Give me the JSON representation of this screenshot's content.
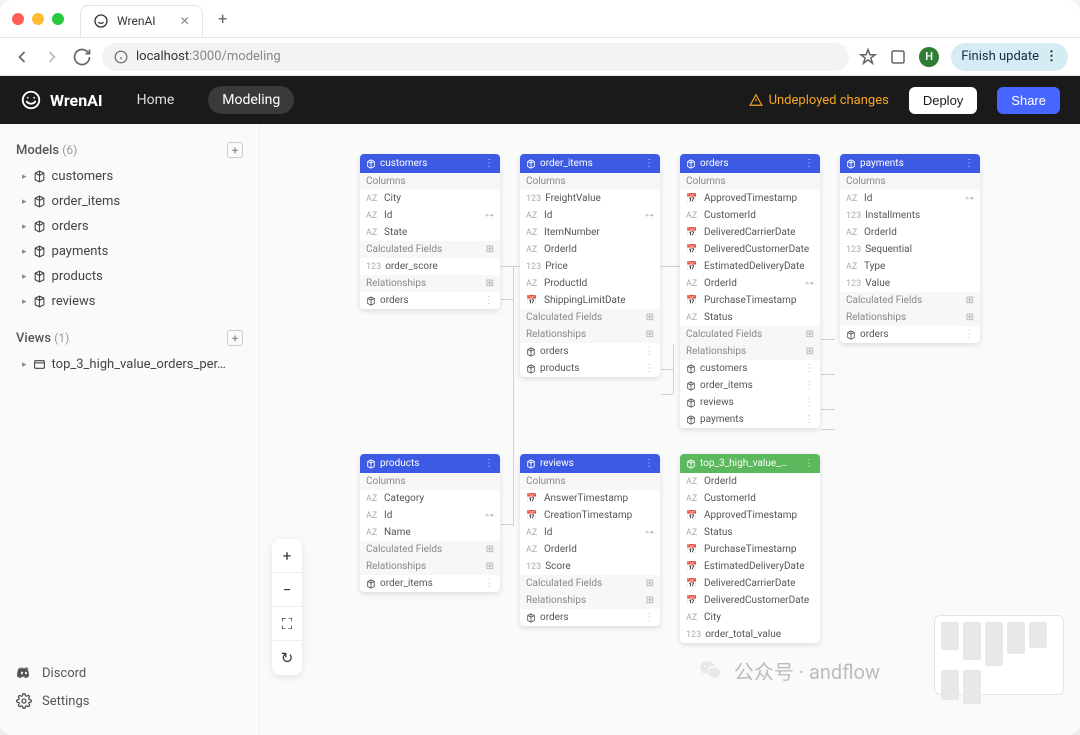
{
  "browser": {
    "tab_title": "WrenAI",
    "url_host": "localhost",
    "url_port_path": ":3000/modeling",
    "finish_label": "Finish update",
    "avatar_letter": "H"
  },
  "topbar": {
    "brand": "WrenAI",
    "nav": {
      "home": "Home",
      "modeling": "Modeling"
    },
    "undeployed": "Undeployed changes",
    "deploy": "Deploy",
    "share": "Share"
  },
  "sidebar": {
    "models_label": "Models",
    "models_count": "(6)",
    "models": [
      "customers",
      "order_items",
      "orders",
      "payments",
      "products",
      "reviews"
    ],
    "views_label": "Views",
    "views_count": "(1)",
    "views": [
      "top_3_high_value_orders_per…"
    ],
    "discord": "Discord",
    "settings": "Settings"
  },
  "labels": {
    "columns": "Columns",
    "calculated": "Calculated Fields",
    "relationships": "Relationships"
  },
  "entities": {
    "customers": {
      "name": "customers",
      "fields": [
        {
          "type": "AZ",
          "name": "City"
        },
        {
          "type": "AZ",
          "name": "Id",
          "key": true
        },
        {
          "type": "AZ",
          "name": "State"
        }
      ],
      "calculated": [
        {
          "type": "123",
          "name": "order_score"
        }
      ],
      "rels": [
        "orders"
      ]
    },
    "order_items": {
      "name": "order_items",
      "fields": [
        {
          "type": "123",
          "name": "FreightValue"
        },
        {
          "type": "AZ",
          "name": "Id",
          "key": true
        },
        {
          "type": "AZ",
          "name": "ItemNumber"
        },
        {
          "type": "AZ",
          "name": "OrderId"
        },
        {
          "type": "123",
          "name": "Price"
        },
        {
          "type": "AZ",
          "name": "ProductId"
        },
        {
          "type": "📅",
          "name": "ShippingLimitDate"
        }
      ],
      "calculated": [],
      "rels": [
        "orders",
        "products"
      ]
    },
    "orders": {
      "name": "orders",
      "fields": [
        {
          "type": "📅",
          "name": "ApprovedTimestamp"
        },
        {
          "type": "AZ",
          "name": "CustomerId"
        },
        {
          "type": "📅",
          "name": "DeliveredCarrierDate"
        },
        {
          "type": "📅",
          "name": "DeliveredCustomerDate"
        },
        {
          "type": "📅",
          "name": "EstimatedDeliveryDate"
        },
        {
          "type": "AZ",
          "name": "OrderId",
          "key": true
        },
        {
          "type": "📅",
          "name": "PurchaseTimestamp"
        },
        {
          "type": "AZ",
          "name": "Status"
        }
      ],
      "calculated": [],
      "rels": [
        "customers",
        "order_items",
        "reviews",
        "payments"
      ]
    },
    "payments": {
      "name": "payments",
      "fields": [
        {
          "type": "AZ",
          "name": "Id",
          "key": true
        },
        {
          "type": "123",
          "name": "Installments"
        },
        {
          "type": "AZ",
          "name": "OrderId"
        },
        {
          "type": "123",
          "name": "Sequential"
        },
        {
          "type": "AZ",
          "name": "Type"
        },
        {
          "type": "123",
          "name": "Value"
        }
      ],
      "calculated": [],
      "rels": [
        "orders"
      ]
    },
    "products": {
      "name": "products",
      "fields": [
        {
          "type": "AZ",
          "name": "Category"
        },
        {
          "type": "AZ",
          "name": "Id",
          "key": true
        },
        {
          "type": "AZ",
          "name": "Name"
        }
      ],
      "calculated": [],
      "rels": [
        "order_items"
      ]
    },
    "reviews": {
      "name": "reviews",
      "fields": [
        {
          "type": "📅",
          "name": "AnswerTimestamp"
        },
        {
          "type": "📅",
          "name": "CreationTimestamp"
        },
        {
          "type": "AZ",
          "name": "Id",
          "key": true
        },
        {
          "type": "AZ",
          "name": "OrderId"
        },
        {
          "type": "123",
          "name": "Score"
        }
      ],
      "calculated": [],
      "rels": [
        "orders"
      ]
    },
    "top3": {
      "name": "top_3_high_value_…",
      "fields": [
        {
          "type": "AZ",
          "name": "OrderId"
        },
        {
          "type": "AZ",
          "name": "CustomerId"
        },
        {
          "type": "📅",
          "name": "ApprovedTimestamp"
        },
        {
          "type": "AZ",
          "name": "Status"
        },
        {
          "type": "📅",
          "name": "PurchaseTimestamp"
        },
        {
          "type": "📅",
          "name": "EstimatedDeliveryDate"
        },
        {
          "type": "📅",
          "name": "DeliveredCarrierDate"
        },
        {
          "type": "📅",
          "name": "DeliveredCustomerDate"
        },
        {
          "type": "AZ",
          "name": "City"
        },
        {
          "type": "123",
          "name": "order_total_value"
        }
      ]
    }
  },
  "watermark": "公众号 · andflow"
}
